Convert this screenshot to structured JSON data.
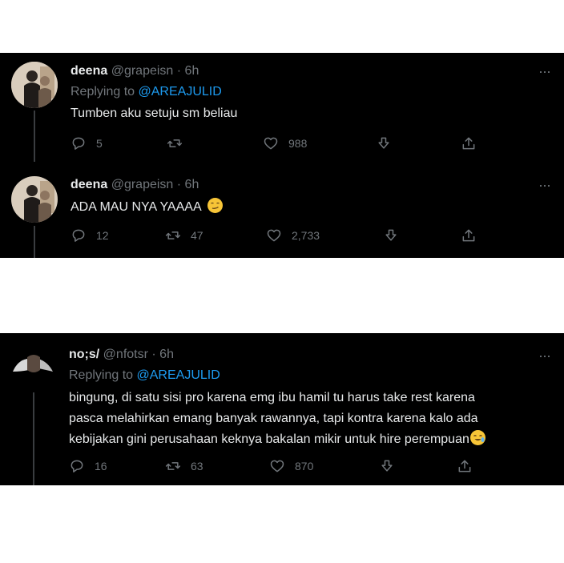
{
  "panel1": {
    "tweets": [
      {
        "name": "deena",
        "handle": "@grapeisn",
        "time": "· 6h",
        "replying_prefix": "Replying to",
        "replying_to": "@AREAJULID",
        "text": "Tumben aku setuju sm beliau",
        "replies": "5",
        "retweets": "",
        "likes": "988"
      },
      {
        "name": "deena",
        "handle": "@grapeisn",
        "time": "· 6h",
        "text": "ADA MAU NYA YAAAA",
        "emoji": "smirking-face",
        "replies": "12",
        "retweets": "47",
        "likes": "2,733"
      }
    ],
    "more": "···"
  },
  "panel2": {
    "tweet": {
      "name": "no;s/",
      "handle": "@nfotsr",
      "time": "· 6h",
      "replying_prefix": "Replying to",
      "replying_to": "@AREAJULID",
      "text_lines": [
        "bingung, di satu sisi pro karena emg ibu hamil tu harus take rest karena",
        "pasca melahirkan emang banyak rawannya, tapi kontra karena kalo ada",
        "kebijakan gini perusahaan keknya bakalan mikir untuk hire perempuan"
      ],
      "emoji": "crying-laughing-face",
      "replies": "16",
      "retweets": "63",
      "likes": "870"
    },
    "more": "···"
  },
  "icons": {
    "reply": "reply-icon",
    "retweet": "retweet-icon",
    "like": "heart-icon",
    "download": "download-icon",
    "share": "share-icon"
  },
  "colors": {
    "background": "#000000",
    "text": "#e7e9ea",
    "muted": "#71767b",
    "mention": "#1d9bf0"
  }
}
